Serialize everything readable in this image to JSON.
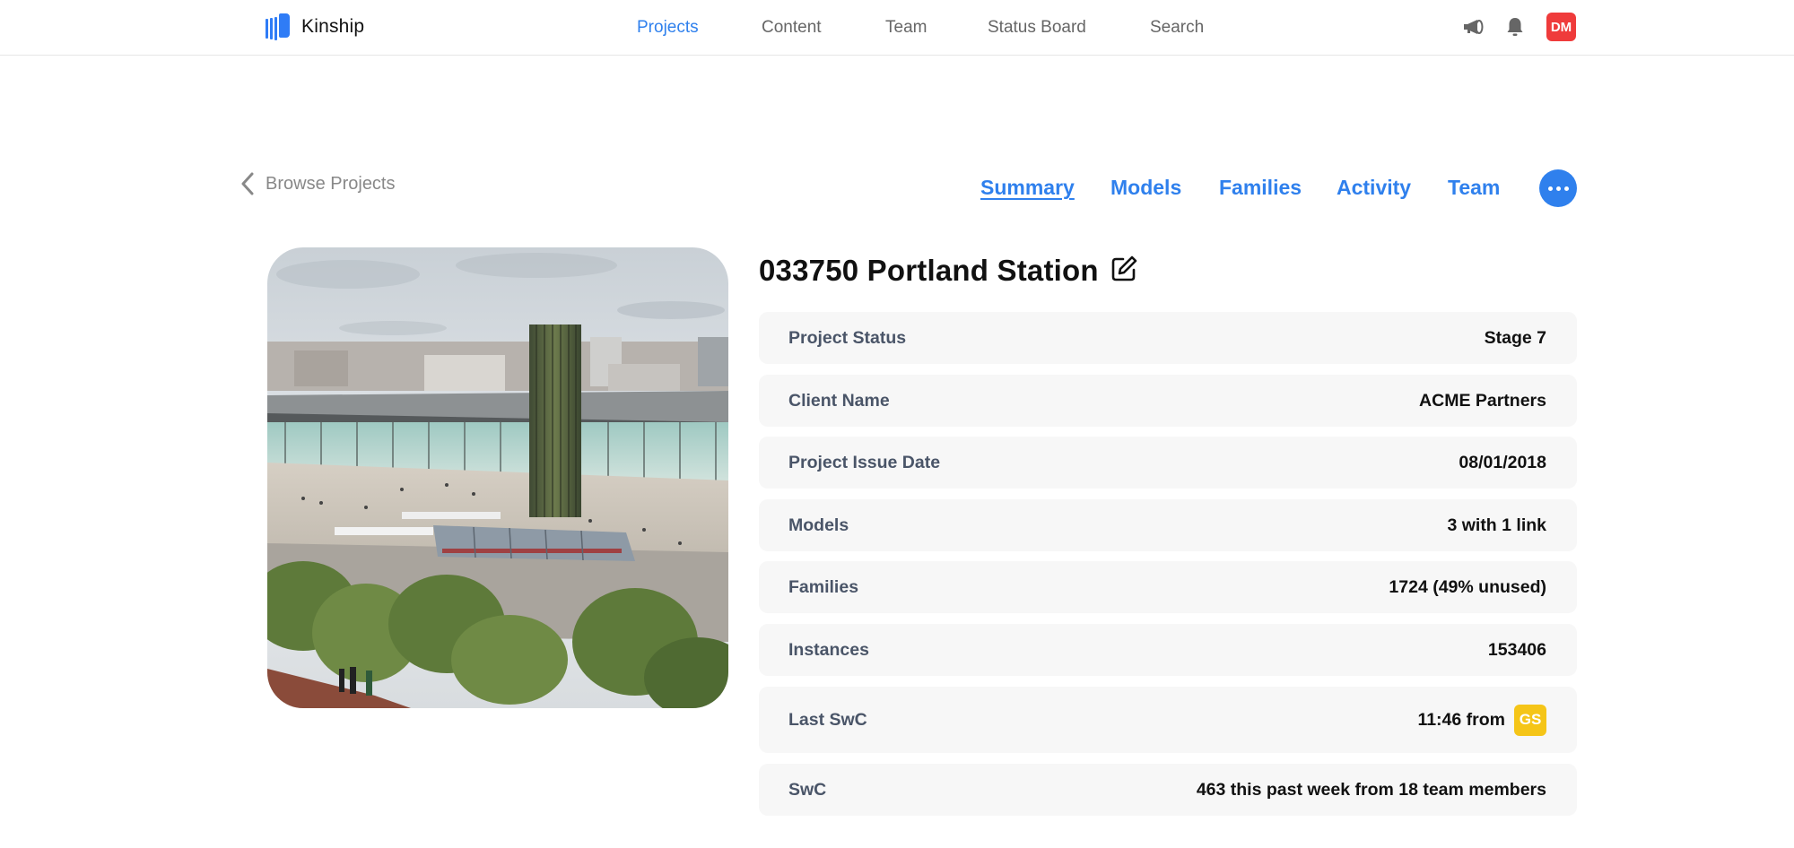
{
  "brand": {
    "name": "Kinship",
    "accent": "#2f80ed"
  },
  "nav": {
    "items": [
      {
        "label": "Projects",
        "active": true
      },
      {
        "label": "Content",
        "active": false
      },
      {
        "label": "Team",
        "active": false
      },
      {
        "label": "Status Board",
        "active": false
      },
      {
        "label": "Search",
        "active": false
      }
    ]
  },
  "header_icons": {
    "announcements": "megaphone-icon",
    "notifications": "bell-icon",
    "user_initials": "DM",
    "user_color": "#ef3b3b"
  },
  "breadcrumb": {
    "back_label": "Browse Projects"
  },
  "tabs": [
    {
      "label": "Summary",
      "active": true
    },
    {
      "label": "Models",
      "active": false
    },
    {
      "label": "Families",
      "active": false
    },
    {
      "label": "Activity",
      "active": false
    },
    {
      "label": "Team",
      "active": false
    }
  ],
  "more_button": "more-options-icon",
  "project": {
    "title": "033750 Portland Station",
    "image_alt": "Rendering of Portland Station with glass tower, tram and trees",
    "details": [
      {
        "label": "Project Status",
        "value": "Stage 7"
      },
      {
        "label": "Client Name",
        "value": "ACME Partners"
      },
      {
        "label": "Project Issue Date",
        "value": "08/01/2018"
      },
      {
        "label": "Models",
        "value": "3 with 1 link"
      },
      {
        "label": "Families",
        "value": "1724 (49% unused)"
      },
      {
        "label": "Instances",
        "value": "153406"
      },
      {
        "label": "Last SwC",
        "value": "11:46 from",
        "badge": "GS",
        "badge_color": "#f5c518"
      },
      {
        "label": "SwC",
        "value": "463 this past week from 18 team members"
      }
    ]
  }
}
